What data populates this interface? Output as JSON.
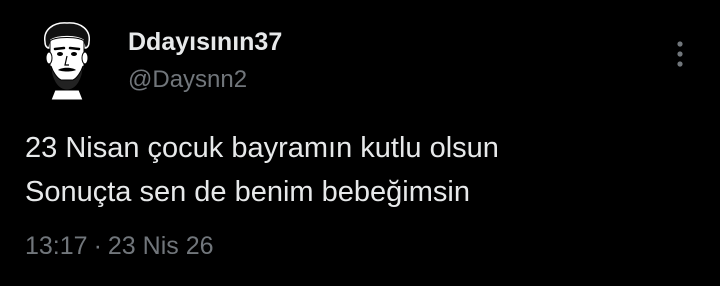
{
  "tweet": {
    "display_name": "Ddayısının37",
    "handle": "@Daysnn2",
    "avatar_icon": "avatar-man-icon",
    "more_icon": "more-vertical-icon",
    "text_lines": [
      "23 Nisan çocuk bayramın kutlu olsun",
      "Sonuçta sen de benim bebeğimsin"
    ],
    "time": "13:17",
    "separator": "·",
    "date": "23 Nis 26"
  },
  "colors": {
    "background": "#000000",
    "primary_text": "#e7e9ea",
    "secondary_text": "#71767b"
  }
}
